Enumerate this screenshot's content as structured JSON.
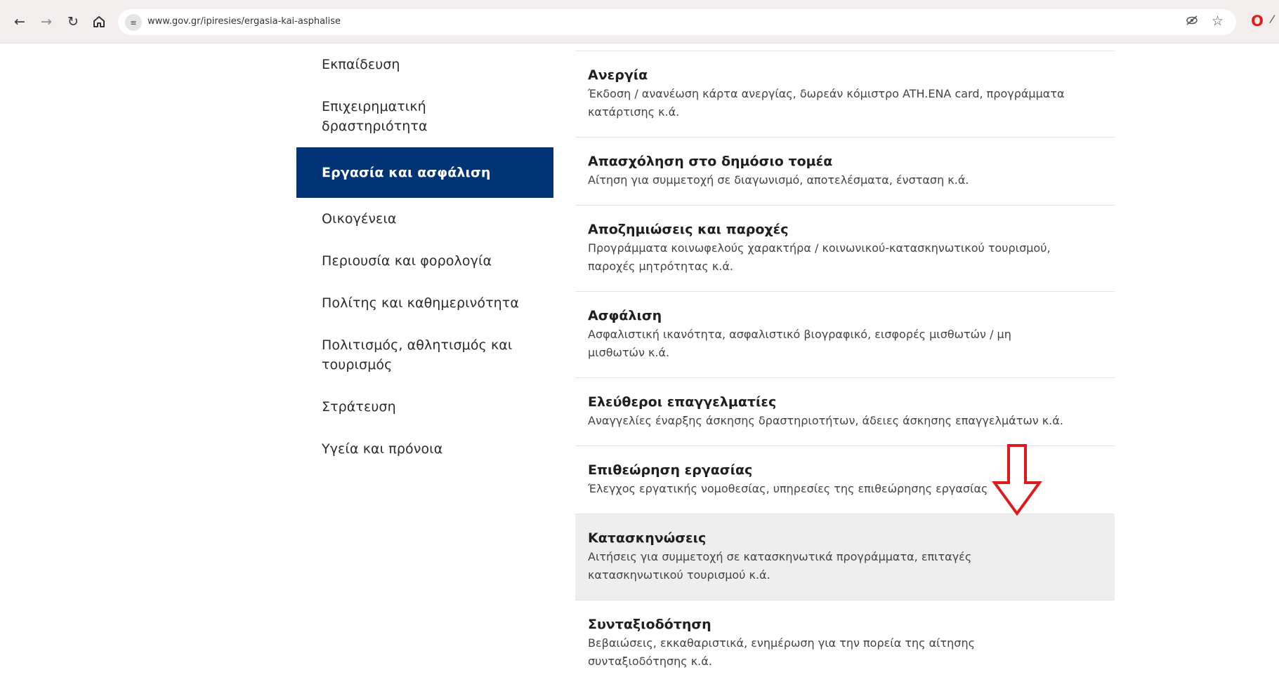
{
  "browser": {
    "url": "www.gov.gr/ipiresies/ergasia-kai-asphalise",
    "icons": [
      "back-arrow-icon",
      "forward-arrow-icon",
      "reload-icon",
      "home-icon",
      "site-info-icon",
      "eye-off-icon",
      "star-icon",
      "opera-icon"
    ]
  },
  "sidebar": {
    "items": [
      {
        "label": "Εκπαίδευση"
      },
      {
        "label": "Επιχειρηματική δραστηριότητα"
      },
      {
        "label": "Εργασία και ασφάλιση"
      },
      {
        "label": "Οικογένεια"
      },
      {
        "label": "Περιουσία και φορολογία"
      },
      {
        "label": "Πολίτης και καθημερινότητα"
      },
      {
        "label": "Πολιτισμός, αθλητισμός και τουρισμός"
      },
      {
        "label": "Στράτευση"
      },
      {
        "label": "Υγεία και πρόνοια"
      }
    ],
    "active_index": 2,
    "active_color": "#003476"
  },
  "services": [
    {
      "title": "Ανεργία",
      "description": "Έκδοση / ανανέωση κάρτα ανεργίας, δωρεάν κόμιστρο ATH.ENA card, προγράμματα κατάρτισης κ.ά."
    },
    {
      "title": "Απασχόληση στο δημόσιο τομέα",
      "description": "Αίτηση για συμμετοχή σε διαγωνισμό, αποτελέσματα, ένσταση κ.ά."
    },
    {
      "title": "Αποζημιώσεις και παροχές",
      "description": "Προγράμματα κοινωφελούς χαρακτήρα / κοινωνικού-κατασκηνωτικού τουρισμού, παροχές μητρότητας κ.ά."
    },
    {
      "title": "Ασφάλιση",
      "description": "Ασφαλιστική ικανότητα, ασφαλιστικό βιογραφικό, εισφορές μισθωτών / μη μισθωτών κ.ά."
    },
    {
      "title": "Ελεύθεροι επαγγελματίες",
      "description": "Αναγγελίες έναρξης άσκησης δραστηριοτήτων, άδειες άσκησης επαγγελμάτων κ.ά."
    },
    {
      "title": "Επιθεώρηση εργασίας",
      "description": "Έλεγχος εργατικής νομοθεσίας, υπηρεσίες της επιθεώρησης εργασίας"
    },
    {
      "title": "Κατασκηνώσεις",
      "description": "Αιτήσεις για συμμετοχή σε κατασκηνωτικά προγράμματα, επιταγές κατασκηνωτικού τουρισμού κ.ά."
    },
    {
      "title": "Συνταξιοδότηση",
      "description": "Βεβαιώσεις, εκκαθαριστικά, ενημέρωση για την πορεία της αίτησης συνταξιοδότησης κ.ά."
    }
  ],
  "highlighted_service_index": 6,
  "annotation": {
    "shape": "down-arrow",
    "color": "#e0191b"
  }
}
